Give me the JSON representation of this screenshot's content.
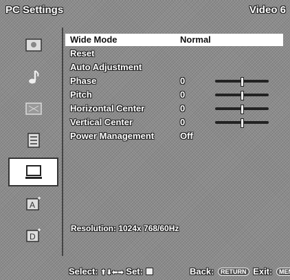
{
  "header": {
    "title": "PC Settings",
    "input": "Video 6"
  },
  "sidebar": {
    "items": [
      {
        "icon": "picture-icon"
      },
      {
        "icon": "sound-icon"
      },
      {
        "icon": "screen-icon"
      },
      {
        "icon": "setup-icon"
      },
      {
        "icon": "pc-icon",
        "active": true
      },
      {
        "icon": "language-icon"
      },
      {
        "icon": "info-icon"
      }
    ]
  },
  "menu": {
    "rows": [
      {
        "label": "Wide Mode",
        "value": "Normal",
        "selected": true
      },
      {
        "label": "Reset",
        "value": ""
      },
      {
        "label": "Auto Adjustment",
        "value": ""
      },
      {
        "label": "Phase",
        "value": "0",
        "slider_level": 0.5
      },
      {
        "label": "Pitch",
        "value": "0",
        "slider_level": 0.5
      },
      {
        "label": "Horizontal Center",
        "value": "0",
        "slider_level": 0.5
      },
      {
        "label": "Vertical Center",
        "value": "0",
        "slider_level": 0.5
      },
      {
        "label": "Power Management",
        "value": "Off"
      }
    ]
  },
  "status": {
    "resolution": "Resolution: 1024x 768/60Hz"
  },
  "footer": {
    "select": "Select:",
    "select_keys": "⬆⬇⬅➡",
    "set": "Set:",
    "back": "Back:",
    "return_key": "RETURN",
    "exit": "Exit:",
    "menu_key": "MENU"
  },
  "colors": {
    "background": "#8c8c8c",
    "highlight": "#ffffff",
    "slider": "#222222"
  }
}
